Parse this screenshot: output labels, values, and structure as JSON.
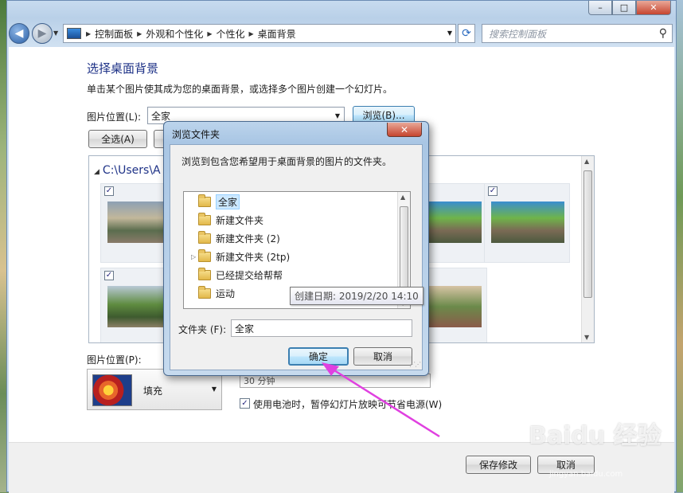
{
  "nav": {
    "breadcrumbs": [
      "控制面板",
      "外观和个性化",
      "个性化",
      "桌面背景"
    ],
    "search_placeholder": "搜索控制面板"
  },
  "main": {
    "title": "选择桌面背景",
    "description": "单击某个图片使其成为您的桌面背景，或选择多个图片创建一个幻灯片。",
    "location_label": "图片位置(L):",
    "location_value": "全家",
    "browse_label": "浏览(B)...",
    "select_all_label": "全选(A)",
    "group_header": "C:\\Users\\A",
    "position_label": "图片位置(P):",
    "position_value": "填充",
    "interval_value": "30 分钟",
    "battery_label": "使用电池时，暂停幻灯片放映可节省电源(W)",
    "save_label": "保存修改",
    "cancel_label": "取消"
  },
  "dialog": {
    "title": "浏览文件夹",
    "description": "浏览到包含您希望用于桌面背景的图片的文件夹。",
    "tree_items": [
      "全家",
      "新建文件夹",
      "新建文件夹 (2)",
      "新建文件夹 (2tp)",
      "已经提交给帮帮",
      "运动"
    ],
    "tooltip": "创建日期: 2019/2/20 14:10",
    "folder_label": "文件夹 (F):",
    "folder_value": "全家",
    "ok_label": "确定",
    "cancel_label": "取消"
  },
  "watermark": {
    "text": "Baidu 经验",
    "sub": "jingyan.baidu.com"
  },
  "colors": {
    "accent_arrow": "#e040e0",
    "title_blue": "#1e3287"
  }
}
